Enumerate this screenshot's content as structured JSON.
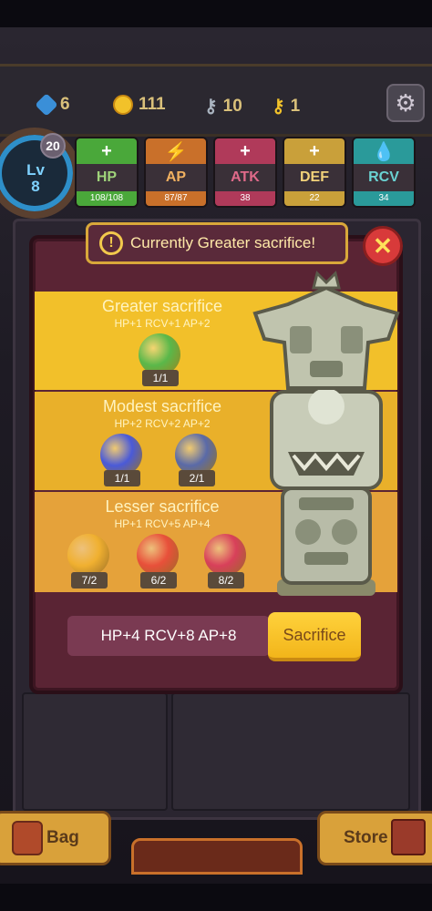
{
  "resources": {
    "gems": "6",
    "coins": "111",
    "silver_keys": "10",
    "gold_keys": "1"
  },
  "level": {
    "label": "Lv",
    "value": "8",
    "badge": "20"
  },
  "stats": [
    {
      "name": "HP",
      "value": "108/108",
      "symbol": "+",
      "color": "#9fd37a",
      "bar": "#4aa83a"
    },
    {
      "name": "AP",
      "value": "87/87",
      "symbol": "⚡",
      "color": "#f0b060",
      "bar": "#c9702a"
    },
    {
      "name": "ATK",
      "value": "38",
      "symbol": "+",
      "color": "#e06a8a",
      "bar": "#b03a5a"
    },
    {
      "name": "DEF",
      "value": "22",
      "symbol": "+",
      "color": "#f2d27a",
      "bar": "#c9a03a"
    },
    {
      "name": "RCV",
      "value": "34",
      "symbol": "💧",
      "color": "#6ad2d2",
      "bar": "#2a9a9a"
    }
  ],
  "banner": {
    "text": "Currently Greater sacrifice!",
    "icon": "exclamation-icon"
  },
  "tiers": [
    {
      "title": "Greater sacrifice",
      "bonus": "HP+1 RCV+1 AP+2",
      "fruits": [
        {
          "count": "1/1",
          "color": "#5ab84a"
        }
      ]
    },
    {
      "title": "Modest sacrifice",
      "bonus": "HP+2 RCV+2 AP+2",
      "fruits": [
        {
          "count": "1/1",
          "color": "#4a5ad8"
        },
        {
          "count": "2/1",
          "color": "#5a6aa8"
        }
      ]
    },
    {
      "title": "Lesser sacrifice",
      "bonus": "HP+1 RCV+5 AP+4",
      "fruits": [
        {
          "count": "7/2",
          "color": "#f0b030"
        },
        {
          "count": "6/2",
          "color": "#e8503a"
        },
        {
          "count": "8/2",
          "color": "#d8405a"
        }
      ]
    }
  ],
  "total": "HP+4 RCV+8 AP+8",
  "sacrifice_label": "Sacrifice",
  "bottom": {
    "bag": "Bag",
    "store": "Store"
  }
}
